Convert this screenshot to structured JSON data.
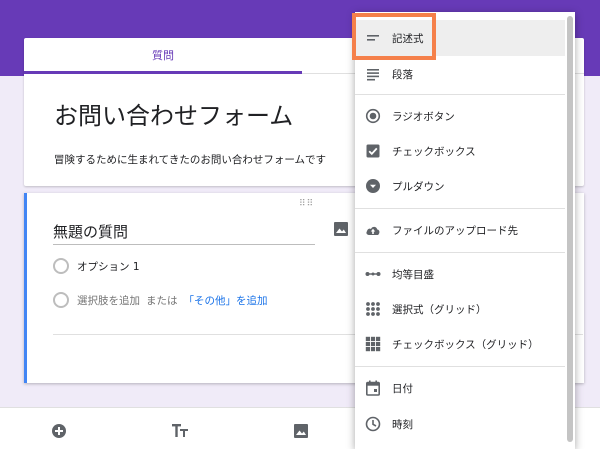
{
  "tabs": {
    "questions_label": "質問"
  },
  "form": {
    "title": "お問い合わせフォーム",
    "description": "冒険するために生まれてきたのお問い合わせフォームです"
  },
  "question": {
    "drag_handle": "⠿⠿",
    "title": "無題の質問",
    "option1": "オプション 1",
    "add_option": "選択肢を追加",
    "or": "または",
    "add_other": "「その他」を追加"
  },
  "menu": {
    "items": [
      {
        "label": "記述式",
        "icon": "short-answer-icon"
      },
      {
        "label": "段落",
        "icon": "paragraph-icon"
      },
      {
        "label": "ラジオボタン",
        "icon": "radio-button-icon"
      },
      {
        "label": "チェックボックス",
        "icon": "checkbox-icon"
      },
      {
        "label": "プルダウン",
        "icon": "dropdown-icon"
      },
      {
        "label": "ファイルのアップロード先",
        "icon": "cloud-upload-icon"
      },
      {
        "label": "均等目盛",
        "icon": "linear-scale-icon"
      },
      {
        "label": "選択式（グリッド）",
        "icon": "grid-icon"
      },
      {
        "label": "チェックボックス（グリッド）",
        "icon": "checkbox-grid-icon"
      },
      {
        "label": "日付",
        "icon": "calendar-icon"
      },
      {
        "label": "時刻",
        "icon": "clock-icon"
      }
    ]
  },
  "colors": {
    "brand": "#673ab7",
    "accent_blue": "#4285f4",
    "link": "#1a73e8",
    "highlight": "#f5804a",
    "background": "#f0ebf8"
  }
}
